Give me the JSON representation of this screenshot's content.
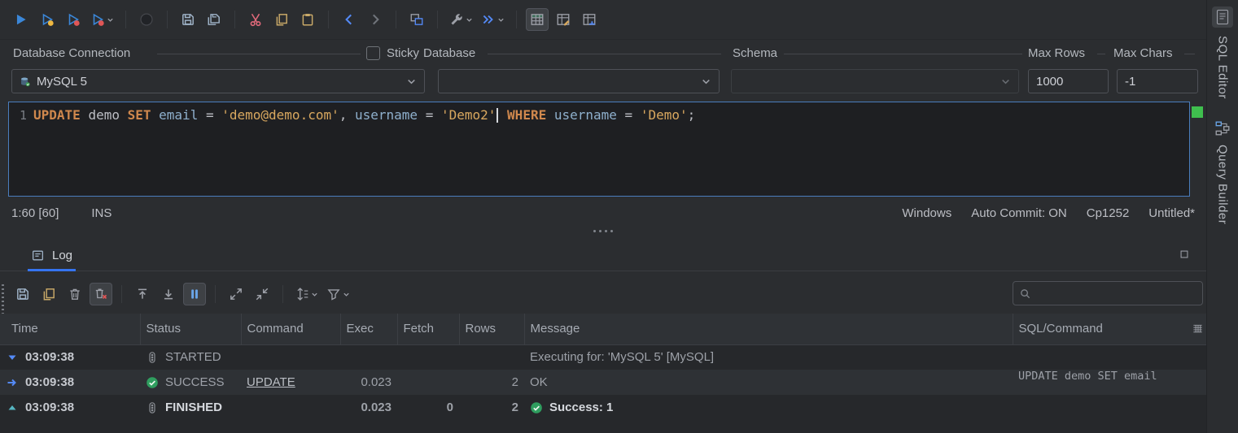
{
  "colors": {
    "accent_blue": "#3574f0",
    "editor_border": "#4a7dbd",
    "keyword": "#d0884d",
    "string": "#d9a85f",
    "column_ident": "#8fb0cd",
    "success_green": "#2f9e5f",
    "stripe_green": "#3fbf4e",
    "link_blue": "#548af7"
  },
  "top_toolbar": {
    "groups": [
      [
        {
          "name": "run"
        },
        {
          "name": "run-current"
        },
        {
          "name": "run-script"
        },
        {
          "name": "run-script-menu",
          "chevron": true
        }
      ],
      [
        {
          "name": "stop"
        }
      ],
      [
        {
          "name": "save"
        },
        {
          "name": "save-all"
        }
      ],
      [
        {
          "name": "cut"
        },
        {
          "name": "copy"
        },
        {
          "name": "paste"
        }
      ],
      [
        {
          "name": "back"
        },
        {
          "name": "forward"
        }
      ],
      [
        {
          "name": "new-window"
        }
      ],
      [
        {
          "name": "tools-menu",
          "chevron": true
        },
        {
          "name": "execute-menu",
          "chevron": true
        }
      ],
      [
        {
          "name": "result-grid",
          "selected": true
        },
        {
          "name": "grid-edit"
        },
        {
          "name": "grid-export"
        }
      ]
    ]
  },
  "connection_bar": {
    "fields": {
      "database_connection": {
        "label": "Database Connection",
        "value": "MySQL 5"
      },
      "sticky": {
        "label": "Sticky",
        "checked": false
      },
      "database": {
        "label": "Database",
        "value": ""
      },
      "schema": {
        "label": "Schema",
        "value": ""
      },
      "max_rows": {
        "label": "Max Rows",
        "value": "1000"
      },
      "max_chars": {
        "label": "Max Chars",
        "value": "-1"
      }
    }
  },
  "editor": {
    "line_number": "1",
    "sql_text": "UPDATE demo SET email = 'demo@demo.com', username = 'Demo2' WHERE username = 'Demo';",
    "tokens": [
      {
        "t": "UPDATE",
        "c": "kw"
      },
      {
        "t": " ",
        "c": "pl"
      },
      {
        "t": "demo",
        "c": "id"
      },
      {
        "t": " ",
        "c": "pl"
      },
      {
        "t": "SET",
        "c": "kw"
      },
      {
        "t": " ",
        "c": "pl"
      },
      {
        "t": "email",
        "c": "col"
      },
      {
        "t": " = ",
        "c": "pl"
      },
      {
        "t": "'demo@demo.com'",
        "c": "str"
      },
      {
        "t": ", ",
        "c": "pl"
      },
      {
        "t": "username",
        "c": "col"
      },
      {
        "t": " = ",
        "c": "pl"
      },
      {
        "t": "'Demo2'",
        "c": "str"
      },
      {
        "t": "",
        "c": "caret"
      },
      {
        "t": " ",
        "c": "pl"
      },
      {
        "t": "WHERE",
        "c": "kw"
      },
      {
        "t": " ",
        "c": "pl"
      },
      {
        "t": "username",
        "c": "col"
      },
      {
        "t": " = ",
        "c": "pl"
      },
      {
        "t": "'Demo'",
        "c": "str"
      },
      {
        "t": ";",
        "c": "pl"
      }
    ],
    "status_bar": {
      "caret_position": "1:60 [60]",
      "input_mode": "INS",
      "right_items": [
        "Windows",
        "Auto Commit: ON",
        "Cp1252",
        "Untitled*"
      ]
    }
  },
  "log_panel": {
    "tab": {
      "label": "Log"
    },
    "toolbar": {
      "groups": [
        [
          {
            "name": "save-log"
          },
          {
            "name": "copy-log"
          },
          {
            "name": "clear-log"
          },
          {
            "name": "clear-before-run",
            "selected": true
          }
        ],
        [
          {
            "name": "scroll-top"
          },
          {
            "name": "scroll-bottom"
          },
          {
            "name": "follow-tail",
            "selected": true
          }
        ],
        [
          {
            "name": "expand-all"
          },
          {
            "name": "collapse-all"
          }
        ],
        [
          {
            "name": "row-height-menu",
            "chevron": true
          },
          {
            "name": "filter-menu",
            "chevron": true
          }
        ]
      ]
    },
    "search": {
      "value": "",
      "placeholder": ""
    },
    "table": {
      "columns": [
        {
          "key": "time",
          "label": "Time"
        },
        {
          "key": "status",
          "label": "Status"
        },
        {
          "key": "command",
          "label": "Command"
        },
        {
          "key": "exec",
          "label": "Exec"
        },
        {
          "key": "fetch",
          "label": "Fetch"
        },
        {
          "key": "rows",
          "label": "Rows"
        },
        {
          "key": "message",
          "label": "Message"
        },
        {
          "key": "sql",
          "label": "SQL/Command"
        }
      ],
      "rows": [
        {
          "expander": "expanded-marker",
          "time": "03:09:38",
          "status": {
            "icon": "state",
            "label": "STARTED",
            "bold": false
          },
          "command": "",
          "exec": "",
          "fetch": "",
          "rows": "",
          "message": {
            "icon": "",
            "text": "Executing for: 'MySQL 5' [MySQL]",
            "bold": false
          },
          "sql": "",
          "highlight": false,
          "bold_numbers": false
        },
        {
          "expander": "current-marker",
          "time": "03:09:38",
          "status": {
            "icon": "success",
            "label": "SUCCESS",
            "bold": false
          },
          "command": "UPDATE",
          "exec": "0.023",
          "fetch": "",
          "rows": "2",
          "message": {
            "icon": "",
            "text": "OK",
            "bold": false
          },
          "sql": "UPDATE demo SET email",
          "highlight": true,
          "bold_numbers": false
        },
        {
          "expander": "collapse-marker",
          "time": "03:09:38",
          "status": {
            "icon": "state",
            "label": "FINISHED",
            "bold": true
          },
          "command": "",
          "exec": "0.023",
          "fetch": "0",
          "rows": "2",
          "message": {
            "icon": "success",
            "text": "Success: 1",
            "bold": true
          },
          "sql": "",
          "highlight": false,
          "bold_numbers": true
        }
      ]
    }
  },
  "right_rail": {
    "tabs": [
      {
        "label": "SQL Editor",
        "icon": "sql-editor-file",
        "active": true
      },
      {
        "label": "Query Builder",
        "icon": "query-builder",
        "active": false
      }
    ]
  }
}
